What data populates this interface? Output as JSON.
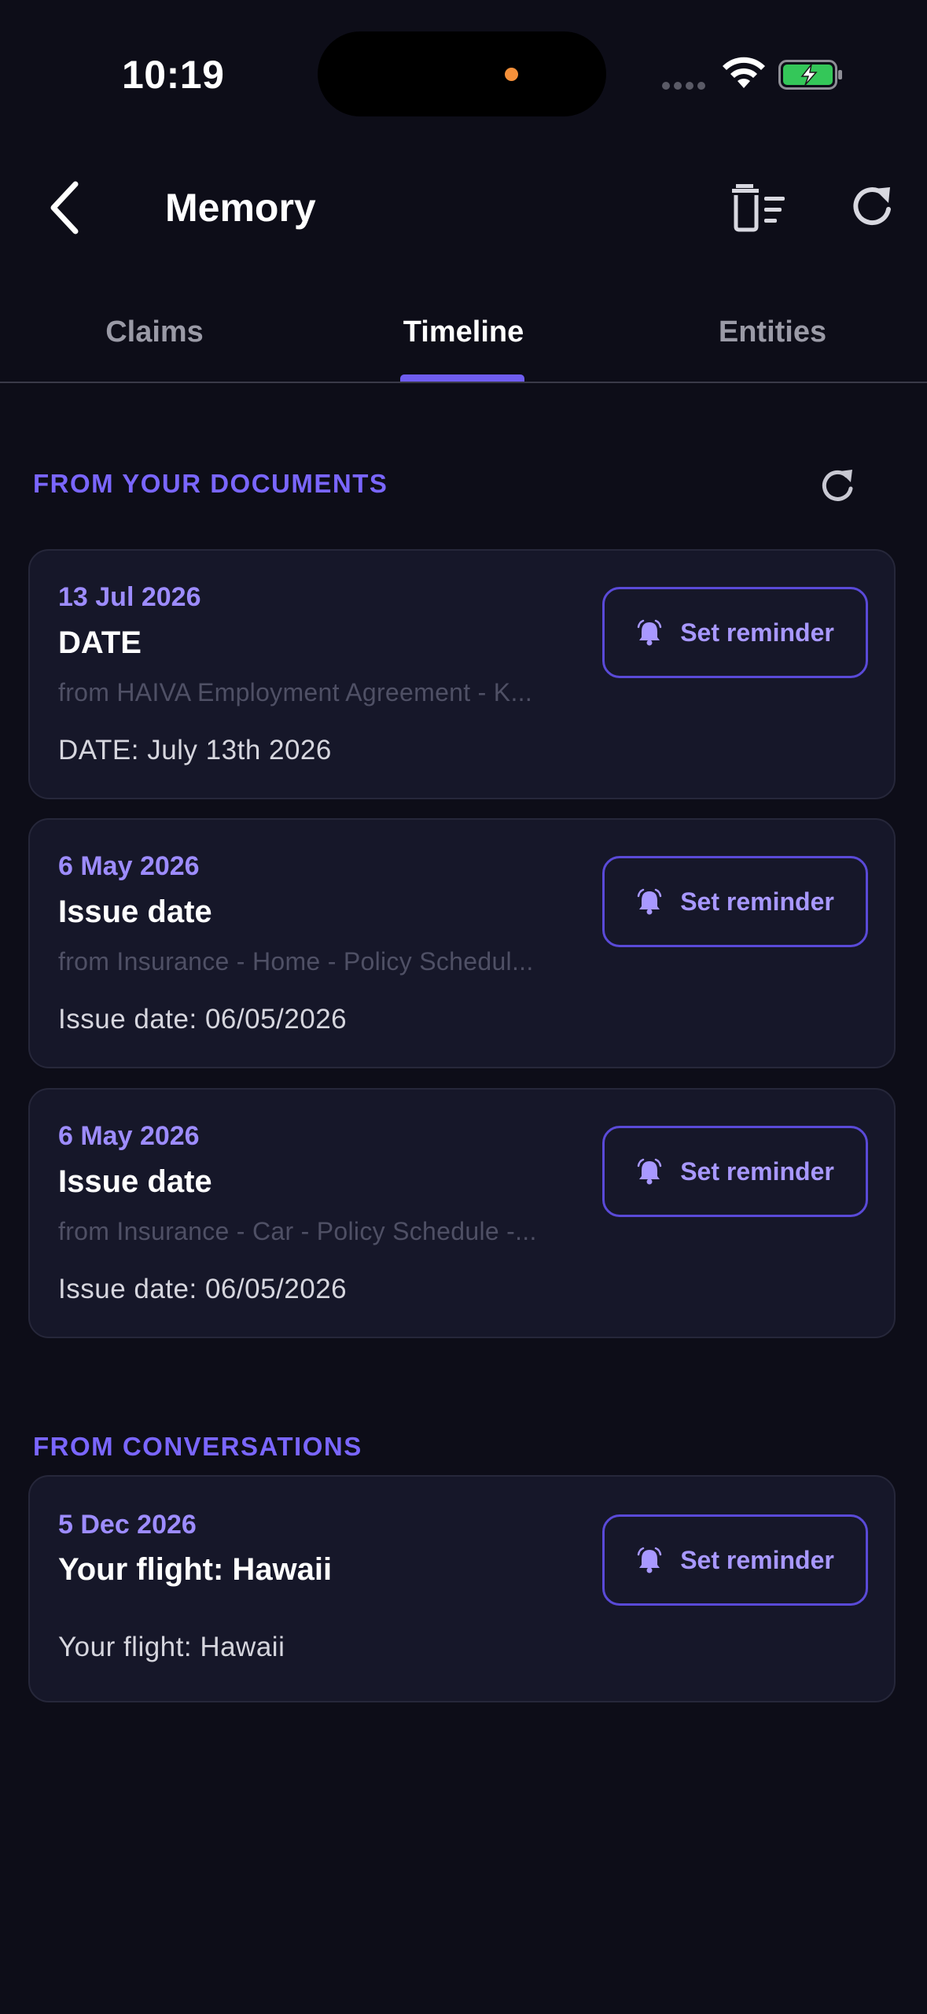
{
  "status_bar": {
    "time": "10:19",
    "island_dot_color": "#f5903a",
    "battery_color": "#34c759"
  },
  "header": {
    "title": "Memory",
    "back_icon": "chevron-left-icon",
    "trash_icon": "trash-list-icon",
    "refresh_icon": "refresh-icon"
  },
  "tabs": [
    {
      "label": "Claims",
      "active": false
    },
    {
      "label": "Timeline",
      "active": true
    },
    {
      "label": "Entities",
      "active": false
    }
  ],
  "colors": {
    "accent": "#6f5df0",
    "section_heading": "#7a66ff",
    "date_text": "#9d8cff",
    "background": "#0d0d18",
    "card_background": "#161729"
  },
  "documents_section": {
    "title": "FROM YOUR DOCUMENTS",
    "items": [
      {
        "date": "13 Jul 2026",
        "title": "DATE",
        "source": "from HAIVA Employment Agreement - K...",
        "detail": "DATE: July 13th 2026",
        "button": "Set reminder"
      },
      {
        "date": "6 May 2026",
        "title": "Issue date",
        "source": "from Insurance - Home - Policy Schedul...",
        "detail": "Issue date: 06/05/2026",
        "button": "Set reminder"
      },
      {
        "date": "6 May 2026",
        "title": "Issue date",
        "source": "from Insurance - Car - Policy Schedule -...",
        "detail": "Issue date: 06/05/2026",
        "button": "Set reminder"
      }
    ]
  },
  "conversations_section": {
    "title": "FROM CONVERSATIONS",
    "items": [
      {
        "date": "5 Dec 2026",
        "title": "Your flight: Hawaii",
        "detail": "Your flight: Hawaii",
        "button": "Set reminder"
      }
    ]
  }
}
